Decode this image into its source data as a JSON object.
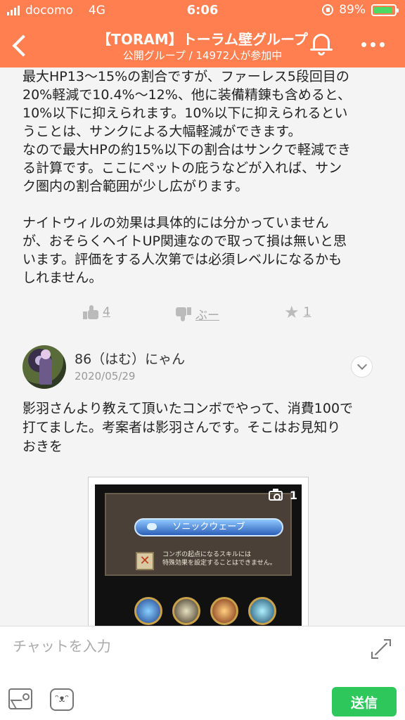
{
  "status_bar": {
    "carrier": "docomo",
    "network": "4G",
    "time": "6:06",
    "battery": "89%",
    "battery_level": 0.89
  },
  "header": {
    "title": "【TORAM】トーラム壁グループ",
    "subtitle": "公開グループ / 14972人が参加中"
  },
  "post": {
    "text": "最大HP13〜15%の割合ですが、ファーレス5段回目の\n20%軽減で10.4%〜12%、他に装備精錬も含めると、\n10%以下に抑えられます。10%以下に抑えられるとい\nうことは、サンクによる大幅軽減ができます。\nなので最大HPの約15%以下の割合はサンクで軽減でき\nる計算です。ここにペットの庇うなどが入れば、サン\nク圏内の割合範囲が少し広がります。\n\nナイトウィルの効果は具体的には分かっていません\nが、おそらくヘイトUP関連なので取って損は無いと思\nいます。評価をする人次第では必須レベルになるかも\nしれません。",
    "likes": "4",
    "dislike_label": "ぶー",
    "stars": "1"
  },
  "comment": {
    "author": "86（はむ）にゃん",
    "date": "2020/05/29",
    "text": "影羽さんより教えて頂いたコンボでやって、消費100で\n打てました。考案者は影羽さんです。そこはお見知り\nおきを",
    "image": {
      "count": "1",
      "skill_name": "ソニックウェーブ",
      "note": "コンボの起点になるスキルには\n特殊効果を設定することはできません。"
    }
  },
  "input_bar": {
    "placeholder": "チャットを入力",
    "stamp_icon": "ᵔᴥᵔ",
    "send_label": "送信"
  },
  "colors": {
    "header": "#ff7f50",
    "send": "#2ec75c",
    "battery": "#4cd964"
  }
}
